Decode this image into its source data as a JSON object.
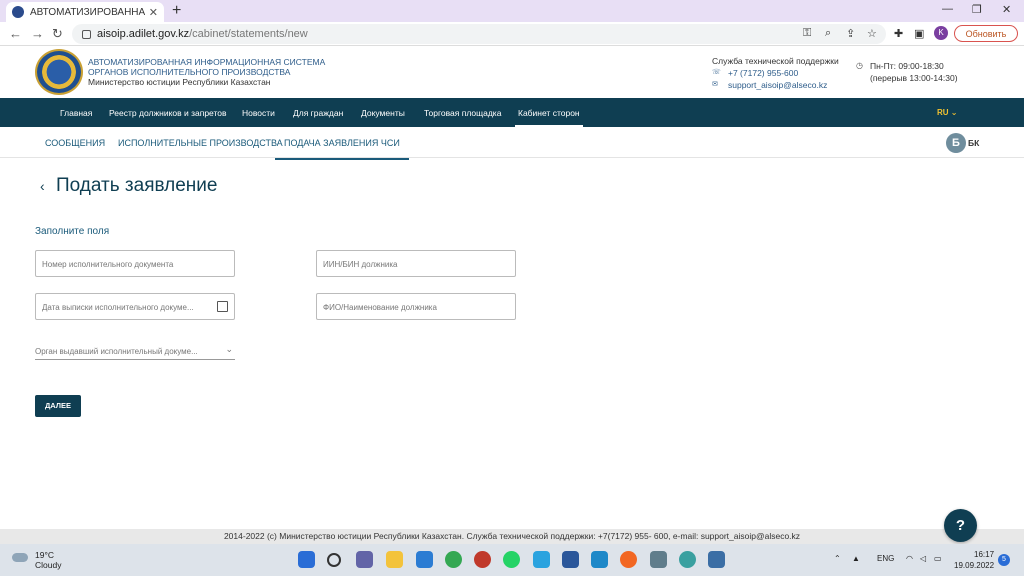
{
  "browser": {
    "tab_title": "АВТОМАТИЗИРОВАННАЯ ИНФ",
    "url_host": "aisoip.adilet.gov.kz",
    "url_path": "/cabinet/statements/new",
    "profile_initial": "K",
    "update_label": "Обновить"
  },
  "header": {
    "system_line1": "АВТОМАТИЗИРОВАННАЯ ИНФОРМАЦИОННАЯ СИСТЕМА",
    "system_line2": "ОРГАНОВ ИСПОЛНИТЕЛЬНОГО ПРОИЗВОДСТВА",
    "ministry": "Министерство юстиции Республики Казахстан",
    "support_title": "Служба технической поддержки",
    "support_phone": "+7 (7172) 955-600",
    "support_email": "support_aisoip@alseco.kz",
    "hours": "Пн-Пт: 09:00-18:30",
    "break": "(перерыв 13:00-14:30)"
  },
  "mainnav": {
    "items": [
      "Главная",
      "Реестр должников и запретов",
      "Новости",
      "Для граждан",
      "Документы",
      "Торговая площадка",
      "Кабинет сторон"
    ],
    "lang": "RU"
  },
  "subnav": {
    "items": [
      "СООБЩЕНИЯ",
      "ИСПОЛНИТЕЛЬНЫЕ ПРОИЗВОДСТВА",
      "ПОДАЧА ЗАЯВЛЕНИЯ ЧСИ"
    ],
    "user_initial": "Б",
    "user_label": "БК"
  },
  "page": {
    "title": "Подать заявление",
    "form_heading": "Заполните поля",
    "field_doc_number": "Номер исполнительного документа",
    "field_iin": "ИИН/БИН должника",
    "field_issue_date": "Дата выписки исполнительного докуме...",
    "field_debtor_name": "ФИО/Наименование должника",
    "field_issuer": "Орган выдавший исполнительный докуме...",
    "next_label": "ДАЛЕЕ"
  },
  "footer": {
    "text": "2014-2022 (c) Министерство юстиции Республики Казахстан. Служба технической поддержки: +7(7172) 955- 600, e-mail: support_aisoip@alseco.kz",
    "help": "?"
  },
  "taskbar": {
    "temperature": "19°C",
    "weather": "Cloudy",
    "lang": "ENG",
    "time": "16:17",
    "date": "19.09.2022",
    "notifications": "5"
  }
}
